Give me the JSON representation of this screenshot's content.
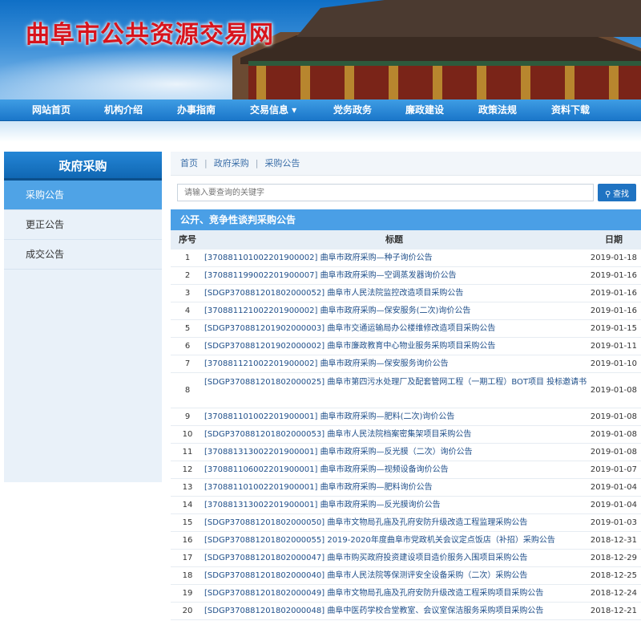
{
  "site": {
    "title": "曲阜市公共资源交易网"
  },
  "nav": [
    "网站首页",
    "机构介绍",
    "办事指南",
    "交易信息 ▾",
    "党务政务",
    "廉政建设",
    "政策法规",
    "资料下载"
  ],
  "sidebar": {
    "title": "政府采购",
    "items": [
      "采购公告",
      "更正公告",
      "成交公告"
    ]
  },
  "breadcrumb": [
    "首页",
    "政府采购",
    "采购公告"
  ],
  "search": {
    "placeholder": "请输入要查询的关键字",
    "button": "查找"
  },
  "section_title": "公开、竞争性谈判采购公告",
  "table": {
    "headers": [
      "序号",
      "标题",
      "日期"
    ],
    "rows": [
      {
        "num": "1",
        "title": "[370881101002201900002] 曲阜市政府采购—种子询价公告",
        "date": "2019-01-18"
      },
      {
        "num": "2",
        "title": "[370881199002201900007] 曲阜市政府采购—空调蒸发器询价公告",
        "date": "2019-01-16"
      },
      {
        "num": "3",
        "title": "[SDGP370881201802000052] 曲阜市人民法院监控改造项目采购公告",
        "date": "2019-01-16"
      },
      {
        "num": "4",
        "title": "[370881121002201900002] 曲阜市政府采购—保安服务(二次)询价公告",
        "date": "2019-01-16"
      },
      {
        "num": "5",
        "title": "[SDGP370881201902000003] 曲阜市交通运输局办公楼维修改造项目采购公告",
        "date": "2019-01-15"
      },
      {
        "num": "6",
        "title": "[SDGP370881201902000002] 曲阜市廉政教育中心物业服务采购项目采购公告",
        "date": "2019-01-11"
      },
      {
        "num": "7",
        "title": "[370881121002201900002] 曲阜市政府采购—保安服务询价公告",
        "date": "2019-01-10"
      },
      {
        "num": "8",
        "title": "[SDGP370881201802000025] 曲阜市第四污水处理厂及配套管网工程（一期工程）BOT项目 投标邀请书",
        "date": "2019-01-08",
        "tall": true
      },
      {
        "num": "9",
        "title": "[370881101002201900001] 曲阜市政府采购—肥料(二次)询价公告",
        "date": "2019-01-08"
      },
      {
        "num": "10",
        "title": "[SDGP370881201802000053] 曲阜市人民法院档案密集架项目采购公告",
        "date": "2019-01-08"
      },
      {
        "num": "11",
        "title": "[370881313002201900001] 曲阜市政府采购—反光膜（二次）询价公告",
        "date": "2019-01-08"
      },
      {
        "num": "12",
        "title": "[370881106002201900001] 曲阜市政府采购—视频设备询价公告",
        "date": "2019-01-07"
      },
      {
        "num": "13",
        "title": "[370881101002201900001] 曲阜市政府采购—肥料询价公告",
        "date": "2019-01-04"
      },
      {
        "num": "14",
        "title": "[370881313002201900001] 曲阜市政府采购—反光膜询价公告",
        "date": "2019-01-04"
      },
      {
        "num": "15",
        "title": "[SDGP370881201802000050] 曲阜市文物局孔庙及孔府安防升级改造工程监理采购公告",
        "date": "2019-01-03"
      },
      {
        "num": "16",
        "title": "[SDGP370881201802000055] 2019-2020年度曲阜市党政机关会议定点饭店（补招）采购公告",
        "date": "2018-12-31"
      },
      {
        "num": "17",
        "title": "[SDGP370881201802000047] 曲阜市购买政府投资建设项目造价服务入围项目采购公告",
        "date": "2018-12-29"
      },
      {
        "num": "18",
        "title": "[SDGP370881201802000040] 曲阜市人民法院等保测评安全设备采购（二次）采购公告",
        "date": "2018-12-25"
      },
      {
        "num": "19",
        "title": "[SDGP370881201802000049] 曲阜市文物局孔庙及孔府安防升级改造工程采购项目采购公告",
        "date": "2018-12-24"
      },
      {
        "num": "20",
        "title": "[SDGP370881201802000048] 曲阜中医药学校合堂教室、会议室保洁服务采购项目采购公告",
        "date": "2018-12-21"
      }
    ]
  }
}
